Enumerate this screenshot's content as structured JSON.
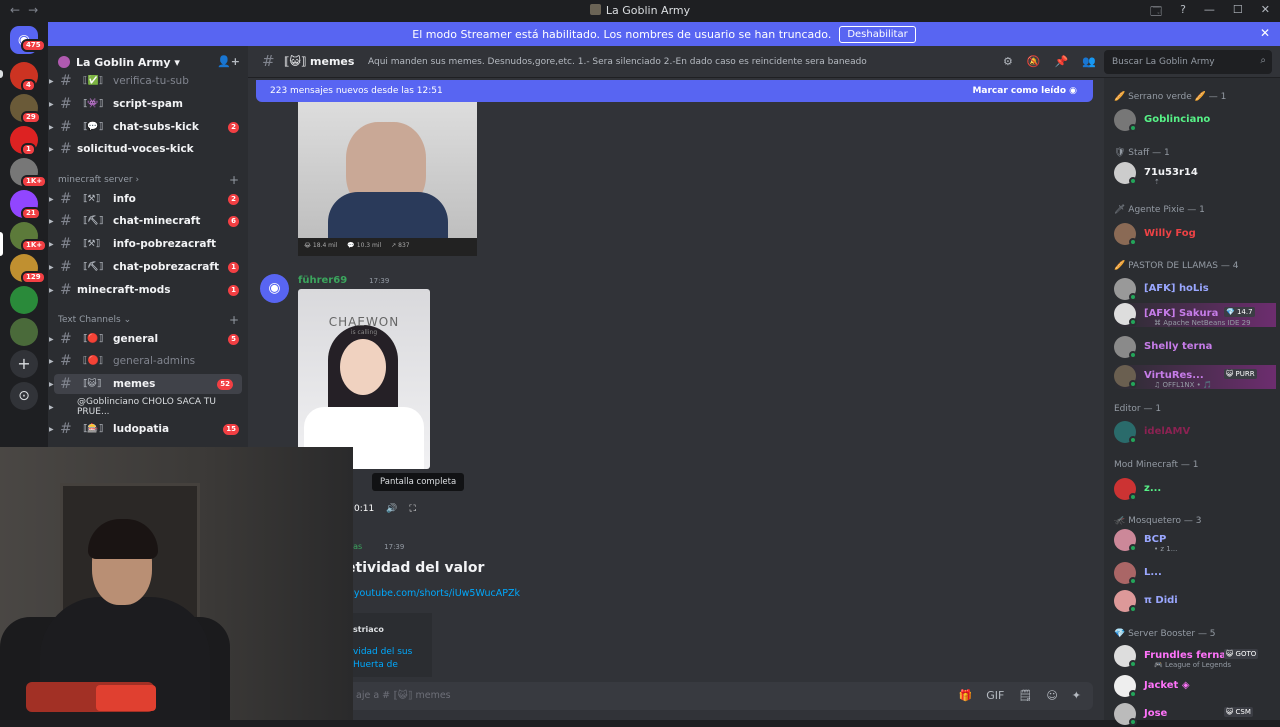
{
  "window": {
    "title": "La Goblin Army",
    "back": "←",
    "forward": "→",
    "controls": [
      "🗔",
      "?",
      "—",
      "☐",
      "✕"
    ]
  },
  "banner": {
    "text": "El modo Streamer está habilitado. Los nombres de usuario se han truncado.",
    "button": "Deshabilitar",
    "close": "✕"
  },
  "guilds": {
    "home_badge": "475",
    "badges": [
      "4",
      "29",
      "1",
      "1K+",
      "21",
      "1K+",
      "129"
    ],
    "add": "+",
    "explore": "⊙"
  },
  "server": {
    "name": "La Goblin Army",
    "chevron": "▾",
    "invite_icon": "👤+"
  },
  "channels": [
    {
      "emoji": "⟦✅⟧",
      "name": "verifica-tu-sub",
      "count": "",
      "muted": true
    },
    {
      "emoji": "⟦👾⟧",
      "name": "script-spam",
      "count": ""
    },
    {
      "emoji": "⟦💬⟧",
      "name": "chat-subs-kick",
      "count": "2"
    },
    {
      "emoji": "",
      "name": "solicitud-voces-kick",
      "count": ""
    }
  ],
  "cat_minecraft": {
    "label": "minecraft server",
    "chevron": "›",
    "plus": "+"
  },
  "minecraft_channels": [
    {
      "emoji": "⟦⚒⟧",
      "name": "info",
      "count": "2"
    },
    {
      "emoji": "⟦⛏⟧",
      "name": "chat-minecraft",
      "count": "6"
    },
    {
      "emoji": "⟦⚒⟧",
      "name": "info-pobrezacraft",
      "count": ""
    },
    {
      "emoji": "⟦⛏⟧",
      "name": "chat-pobrezacraft",
      "count": "1"
    },
    {
      "emoji": "",
      "name": "minecraft-mods",
      "count": "1"
    }
  ],
  "cat_text": {
    "label": "Text Channels",
    "chevron": "⌄",
    "plus": "+"
  },
  "text_channels": [
    {
      "emoji": "⟦🔴⟧",
      "name": "general",
      "count": "5"
    },
    {
      "emoji": "⟦🔴⟧",
      "name": "general-admins",
      "count": "",
      "muted": true
    },
    {
      "emoji": "⟦😺⟧",
      "name": "memes",
      "count": "52",
      "selected": true
    },
    {
      "emoji": "",
      "name": "@Goblinciano CHOLO SACA TU PRUE...",
      "count": "",
      "thread": true
    },
    {
      "emoji": "⟦🎰⟧",
      "name": "ludopatia",
      "count": "15"
    }
  ],
  "topbar": {
    "hash": "#",
    "channel": "⟦😺⟧ memes",
    "topic": "Aqui manden sus memes. Desnudos,gore,etc. 1.- Sera silenciado 2.-En dado caso es reincidente sera baneado",
    "icons": [
      "⚙",
      "🔕",
      "📌",
      "👥"
    ]
  },
  "search": {
    "placeholder": "Buscar La Goblin Army",
    "icon": "⌕"
  },
  "newbar": {
    "text": "223 mensajes nuevos desde las 12:51",
    "mark": "Marcar como leído ◉"
  },
  "img1_stats": [
    "😂 18.4 mil",
    "💬 10.3 mil",
    "↗ 837"
  ],
  "message": {
    "author": "führer69",
    "time": "17:39",
    "video_text": "CHAEWON",
    "video_sub": "is calling"
  },
  "tooltip": "Pantalla completa",
  "video_controls": {
    "time": "0:11",
    "volume": "🔊",
    "fullscreen": "⛶"
  },
  "message2": {
    "author": "bas",
    "time": "17:39",
    "title": "etividad del valor",
    "link": "v.youtube.com/shorts/iUw5WucAPZk",
    "embed_provider": "striaco",
    "embed_link": "vidad del sus Huerta de"
  },
  "compose": {
    "placeholder": "aje a # ⟦😺⟧ memes",
    "icons": [
      "🎁",
      "GIF",
      "🗒",
      "☺",
      "✦"
    ]
  },
  "members": {
    "groups": [
      {
        "label": "🥖 Serrano verde 🥖 — 1",
        "members": [
          {
            "name": "Goblinciano",
            "color": "#57f287",
            "status": "",
            "avatar": "#777"
          }
        ]
      },
      {
        "label": "🛡 Staff — 1",
        "members": [
          {
            "name": "71u53r14",
            "color": "#f2f3f5",
            "status": "⇡",
            "avatar": "#ccc"
          }
        ]
      },
      {
        "label": "🗡 Agente Pixie — 1",
        "members": [
          {
            "name": "Willy Fog",
            "color": "#ed4245",
            "status": "",
            "avatar": "#8a6a55"
          }
        ]
      },
      {
        "label": "🥖 PASTOR DE LLAMAS — 4",
        "members": [
          {
            "name": "[AFK] hoLis",
            "color": "#9aa7ff",
            "status": "",
            "avatar": "#999"
          },
          {
            "name": "[AFK] Sakura",
            "color": "#c67ce8",
            "status": "⌘ Apache NetBeans IDE 29",
            "avatar": "#ddd",
            "tag": "💎 14.7",
            "highlight": true
          },
          {
            "name": "Shelly terna",
            "color": "#c67ce8",
            "status": "",
            "avatar": "#8a8a8a"
          },
          {
            "name": "VirtuRes...",
            "color": "#c67ce8",
            "status": "♫ OFFL1NX • 🎵",
            "avatar": "#6a5f50",
            "tag": "😺 PURR",
            "highlight": true
          }
        ]
      },
      {
        "label": "Editor — 1",
        "members": [
          {
            "name": "idelAMV",
            "color": "#8b2252",
            "status": "",
            "avatar": "#2a6b6b"
          }
        ]
      },
      {
        "label": "Mod Minecraft — 1",
        "members": [
          {
            "name": "z...",
            "color": "#57f287",
            "status": "",
            "avatar": "#c33"
          }
        ]
      },
      {
        "label": "🦟 Mosquetero — 3",
        "members": [
          {
            "name": "BCP",
            "color": "#9aa7ff",
            "status": "• z 1...",
            "avatar": "#c89"
          },
          {
            "name": "L...",
            "color": "#9aa7ff",
            "status": "",
            "avatar": "#a66"
          },
          {
            "name": "π Didi",
            "color": "#9aa7ff",
            "status": "",
            "avatar": "#d99"
          }
        ]
      },
      {
        "label": "💎 Server Booster — 5",
        "members": [
          {
            "name": "Frundles ferna...",
            "color": "#ff73fa",
            "status": "🎮 League of Legends",
            "avatar": "#ddd",
            "tag": "😺 GOTO"
          },
          {
            "name": "Jacket ◈",
            "color": "#ff73fa",
            "status": "",
            "avatar": "#eee"
          },
          {
            "name": "Jose",
            "color": "#ff73fa",
            "status": "",
            "avatar": "#bbb",
            "tag": "😺 CSM"
          }
        ]
      }
    ]
  },
  "colors": {
    "blurple": "#5865f2",
    "red": "#f23f43",
    "bg": "#313338"
  }
}
